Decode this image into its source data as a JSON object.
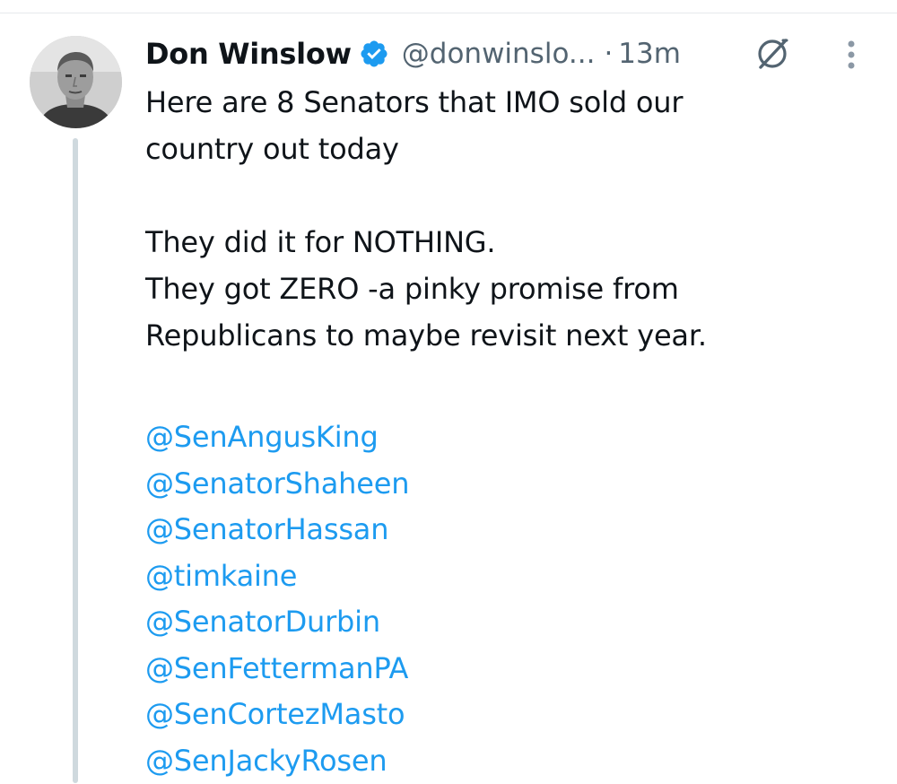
{
  "tweet": {
    "author": {
      "display_name": "Don Winslow",
      "handle": "@donwinslo...",
      "verified": true,
      "avatar_icon": "person-avatar"
    },
    "separator": "·",
    "timestamp": "13m",
    "body": {
      "paragraph_1_line_1": "Here are 8 Senators that IMO sold our",
      "paragraph_1_line_2": "country out today",
      "paragraph_2_line_1": "They did it for NOTHING.",
      "paragraph_2_line_2": "They got ZERO -a pinky promise from",
      "paragraph_2_line_3": "Republicans to maybe revisit next year."
    },
    "mentions": [
      "@SenAngusKing",
      "@SenatorShaheen",
      "@SenatorHassan",
      "@timkaine",
      "@SenatorDurbin",
      "@SenFettermanPA",
      "@SenCortezMasto",
      "@SenJackyRosen"
    ],
    "icons": {
      "verified": "verified-badge-icon",
      "grok": "grok-icon",
      "more": "more-vertical-icon"
    }
  },
  "colors": {
    "text_primary": "#0f1419",
    "text_secondary": "#536471",
    "link": "#1d9bf0",
    "verified_badge": "#1d9bf0",
    "thread_line": "#cfd9de"
  }
}
